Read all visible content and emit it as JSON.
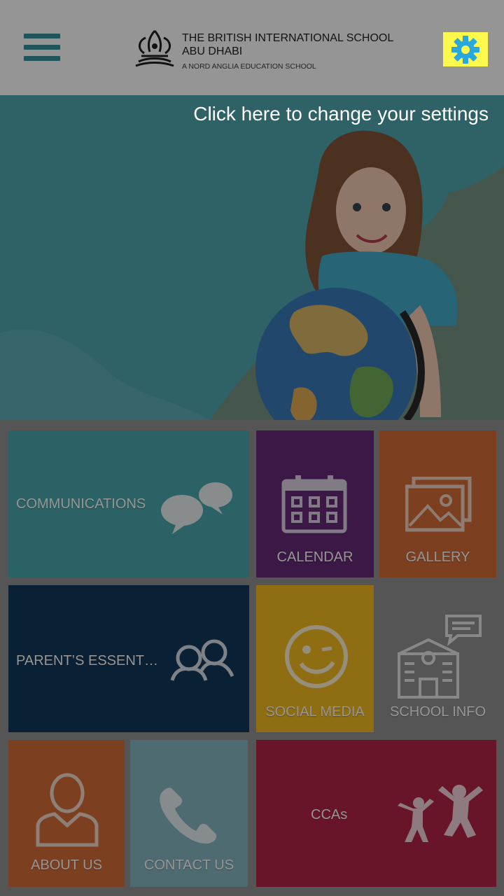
{
  "header": {
    "school_line1": "THE BRITISH INTERNATIONAL SCHOOL",
    "school_line2": "ABU DHABI",
    "school_line3": "A NORD ANGLIA EDUCATION SCHOOL"
  },
  "hint": {
    "text": "Click here to change your settings"
  },
  "tiles": [
    {
      "label": "COMMUNICATIONS",
      "color": "#3fa2aa"
    },
    {
      "label": "CALENDAR",
      "color": "#5b1c6f"
    },
    {
      "label": "GALLERY",
      "color": "#d1642c"
    },
    {
      "label": "PARENT’S ESSENT…",
      "color": "#032a4f"
    },
    {
      "label": "SOCIAL MEDIA",
      "color": "#f5b611"
    },
    {
      "label": "SCHOOL INFO",
      "color": "#8a8b8c"
    },
    {
      "label": "ABOUT US",
      "color": "#d1642c"
    },
    {
      "label": "CONTACT US",
      "color": "#7fb3be"
    },
    {
      "label": "CCAs",
      "color": "#b0163b"
    }
  ],
  "colors": {
    "accent": "#2a8b96",
    "settings_highlight": "#fff94d"
  }
}
